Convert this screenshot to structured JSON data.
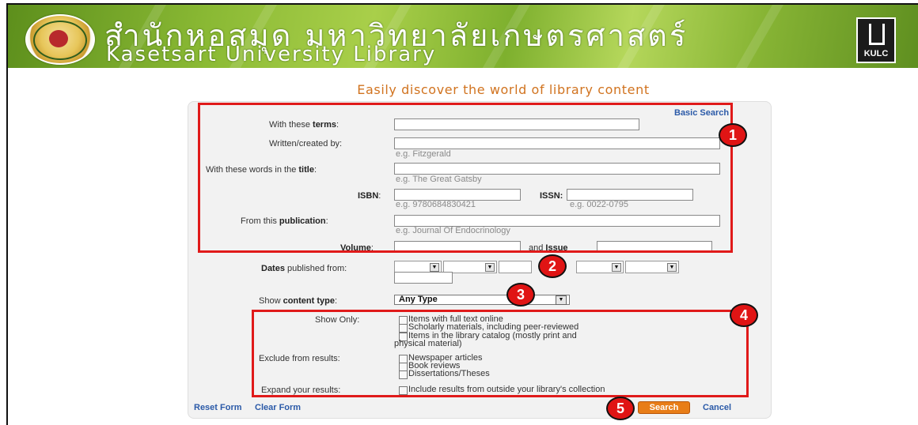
{
  "banner": {
    "thai_title": "สำนักหอสมุด มหาวิทยาลัยเกษตรศาสตร์",
    "english_title": "Kasetsart University Library",
    "logo_text": "KULC",
    "seal_icon": "university-seal-icon"
  },
  "tagline": "Easily discover the world of library content",
  "form": {
    "basic_search_link": "Basic Search",
    "terms": {
      "label_pre": "With these ",
      "label_bold": "terms",
      "label_post": ":",
      "value": ""
    },
    "author": {
      "label": "Written/created by:",
      "value": "",
      "hint": "e.g. Fitzgerald"
    },
    "title": {
      "label_pre": "With these words in the ",
      "label_bold": "title",
      "label_post": ":",
      "value": "",
      "hint": "e.g. The Great Gatsby"
    },
    "isbn": {
      "label_bold": "ISBN",
      "label_post": ":",
      "value": "",
      "hint": "e.g. 9780684830421"
    },
    "issn": {
      "label_bold": "ISSN:",
      "value": "",
      "hint": "e.g. 0022-0795"
    },
    "publication": {
      "label_pre": "From this ",
      "label_bold": "publication",
      "label_post": ":",
      "value": "",
      "hint": "e.g. Journal Of Endocrinology"
    },
    "volume": {
      "label_bold": "Volume",
      "label_post": ":",
      "value": ""
    },
    "issue": {
      "label_pre": "and ",
      "label_bold": "Issue",
      "value": ""
    },
    "dates": {
      "label_bold": "Dates",
      "label_post": " published from:"
    },
    "content_type": {
      "label_pre": "Show ",
      "label_bold": "content type",
      "label_post": ":",
      "selected": "Any Type"
    },
    "show_only": {
      "label": "Show Only:",
      "options": [
        "Items with full text online",
        "Scholarly materials, including peer-reviewed",
        "Items in the library catalog (mostly print and",
        "physical material)"
      ]
    },
    "exclude": {
      "label": "Exclude from results:",
      "options": [
        "Newspaper articles",
        "Book reviews",
        "Dissertations/Theses"
      ]
    },
    "expand": {
      "label": "Expand your results:",
      "option": "Include results from outside your library's collection"
    },
    "reset_link": "Reset Form",
    "clear_link": "Clear Form",
    "search_button": "Search",
    "cancel_link": "Cancel"
  },
  "annotations": {
    "badges": [
      "1",
      "2",
      "3",
      "4",
      "5"
    ],
    "color": "#e01a1a"
  },
  "colors": {
    "tagline": "#d1731f",
    "link": "#2b5aa8",
    "search_button": "#e87d18",
    "banner_green": "#8ab934"
  }
}
